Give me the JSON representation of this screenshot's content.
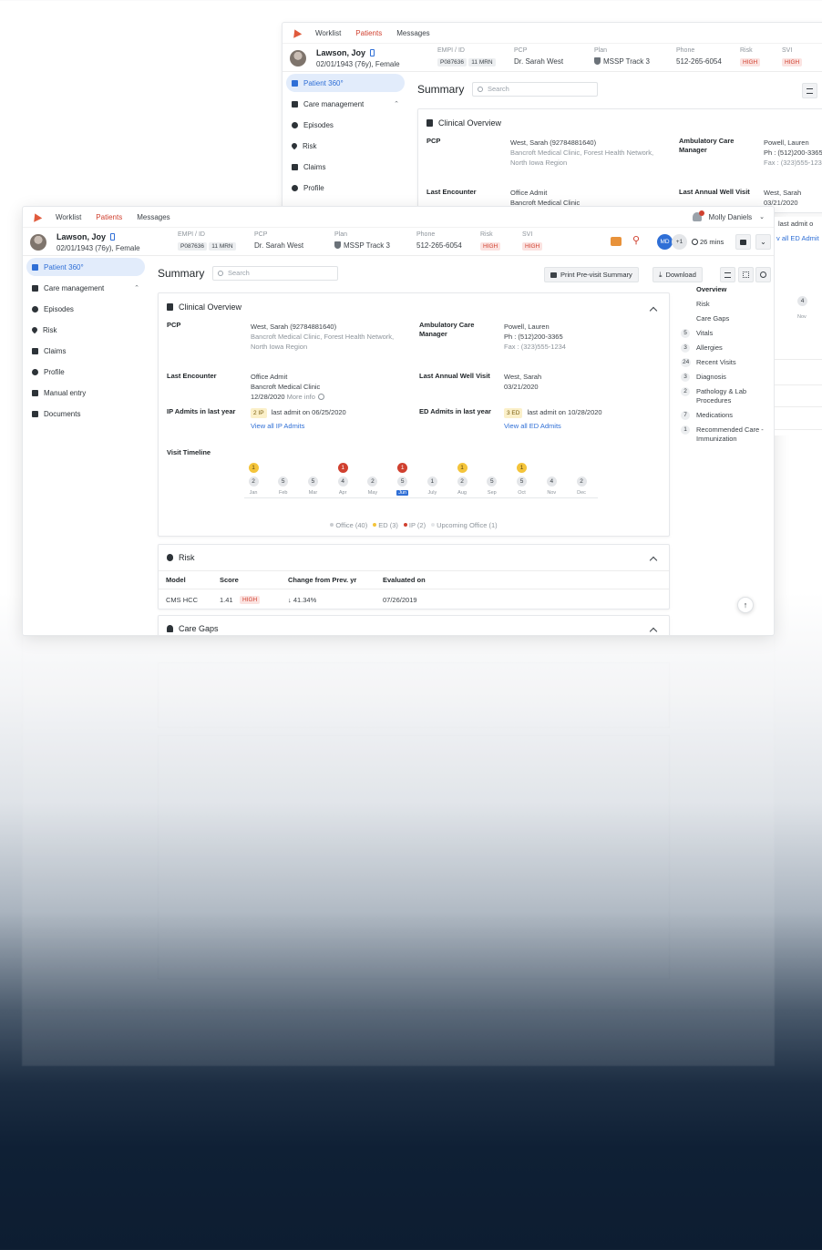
{
  "nav": {
    "worklist": "Worklist",
    "patients": "Patients",
    "messages": "Messages"
  },
  "user": {
    "name": "Molly Daniels",
    "initials": "MD",
    "plus": "+1",
    "timer": "26 mins"
  },
  "patient": {
    "name": "Lawson, Joy",
    "dob": "02/01/1943 (76y), Female",
    "empi_label": "EMPI / ID",
    "empi_id": "P087636",
    "mrn": "11 MRN",
    "pcp_label": "PCP",
    "pcp": "Dr. Sarah West",
    "plan_label": "Plan",
    "plan": "MSSP Track 3",
    "phone_label": "Phone",
    "phone": "512-265-6054",
    "risk_label": "Risk",
    "risk": "HIGH",
    "svi_label": "SVI",
    "svi": "HIGH"
  },
  "sidebar": {
    "items": [
      {
        "label": "Patient 360°",
        "icon": "patient-icon"
      },
      {
        "label": "Care management",
        "icon": "chat-icon"
      },
      {
        "label": "Episodes",
        "icon": "episodes-icon"
      },
      {
        "label": "Risk",
        "icon": "heart-icon"
      },
      {
        "label": "Claims",
        "icon": "claims-icon"
      },
      {
        "label": "Profile",
        "icon": "profile-icon"
      },
      {
        "label": "Manual entry",
        "icon": "manual-entry-icon"
      },
      {
        "label": "Documents",
        "icon": "documents-icon"
      }
    ]
  },
  "summary": {
    "title": "Summary",
    "search_placeholder": "Search",
    "print_label": "Print Pre-visit Summary",
    "download_label": "Download"
  },
  "clinical": {
    "title": "Clinical Overview",
    "pcp_label": "PCP",
    "pcp_name": "West, Sarah (92784881640)",
    "pcp_org": "Bancroft Medical Clinic, Forest Health Network,",
    "pcp_region": "North Iowa Region",
    "acm_label_1": "Ambulatory Care",
    "acm_label_2": "Manager",
    "acm_name": "Powell, Lauren",
    "acm_phone": "Ph : (512)200-3365",
    "acm_fax": "Fax : (323)555-1234",
    "last_enc_label": "Last Encounter",
    "last_enc_type": "Office Admit",
    "last_enc_place": "Bancroft Medical Clinic",
    "last_enc_date": "12/28/2020",
    "more_info": "More info",
    "awv_label": "Last Annual Well Visit",
    "awv_name": "West, Sarah",
    "awv_date": "03/21/2020",
    "ip_label": "IP Admits in last year",
    "ip_badge": "2 IP",
    "ip_last": "last admit on 06/25/2020",
    "ip_link": "View all IP Admits",
    "ed_label": "ED Admits in last year",
    "ed_badge": "3 ED",
    "ed_last": "last admit on 10/28/2020",
    "ed_link": "View all ED Admits",
    "timeline_label": "Visit Timeline"
  },
  "timeline": {
    "months": [
      {
        "m": "Jan",
        "office": 2,
        "event": "1",
        "event_type": "ed"
      },
      {
        "m": "Feb",
        "office": 5,
        "event": null,
        "event_type": null
      },
      {
        "m": "Mar",
        "office": 5,
        "event": null,
        "event_type": null
      },
      {
        "m": "Apr",
        "office": 4,
        "event": "1",
        "event_type": "ip"
      },
      {
        "m": "May",
        "office": 2,
        "event": null,
        "event_type": null
      },
      {
        "m": "Jun",
        "office": 5,
        "event": "1",
        "event_type": "ip",
        "current": true
      },
      {
        "m": "July",
        "office": 1,
        "event": null,
        "event_type": null
      },
      {
        "m": "Aug",
        "office": 2,
        "event": "1",
        "event_type": "ed"
      },
      {
        "m": "Sep",
        "office": 5,
        "event": null,
        "event_type": null
      },
      {
        "m": "Oct",
        "office": 5,
        "event": "1",
        "event_type": "ed"
      },
      {
        "m": "Nov",
        "office": 4,
        "event": null,
        "event_type": null
      },
      {
        "m": "Dec",
        "office": 2,
        "event": null,
        "event_type": null
      }
    ],
    "legend": [
      {
        "label": "Office (40)",
        "color": "#c9ccd0"
      },
      {
        "label": "ED (3)",
        "color": "#f4c43a"
      },
      {
        "label": "IP (2)",
        "color": "#d0402f"
      },
      {
        "label": "Upcoming Office (1)",
        "color": "#e4e6e9"
      }
    ]
  },
  "toc": {
    "items": [
      {
        "label": "Overview",
        "count": null,
        "bold": true
      },
      {
        "label": "Risk",
        "count": null
      },
      {
        "label": "Care Gaps",
        "count": null
      },
      {
        "label": "Vitals",
        "count": "5"
      },
      {
        "label": "Allergies",
        "count": "3"
      },
      {
        "label": "Recent Visits",
        "count": "24"
      },
      {
        "label": "Diagnosis",
        "count": "3"
      },
      {
        "label": "Pathology & Lab Procedures",
        "count": "2"
      },
      {
        "label": "Medications",
        "count": "7"
      },
      {
        "label": "Recommended Care - Immunization",
        "count": "1"
      }
    ]
  },
  "risk": {
    "title": "Risk",
    "col_model": "Model",
    "col_score": "Score",
    "col_change": "Change from Prev. yr",
    "col_eval": "Evaluated on",
    "row_model": "CMS HCC",
    "row_score": "1.41",
    "row_level": "HIGH",
    "row_change": "↓ 41.34%",
    "row_eval": "07/26/2019"
  },
  "care_gaps": {
    "title": "Care Gaps"
  },
  "overhang": {
    "admit": "last admit o",
    "link": "v all ED Admit",
    "month_label": "Nov",
    "count": "4"
  },
  "colors": {
    "accent": "#2f6fd6",
    "brand": "#d0402f",
    "ed": "#f4c43a",
    "ip": "#d0402f"
  }
}
